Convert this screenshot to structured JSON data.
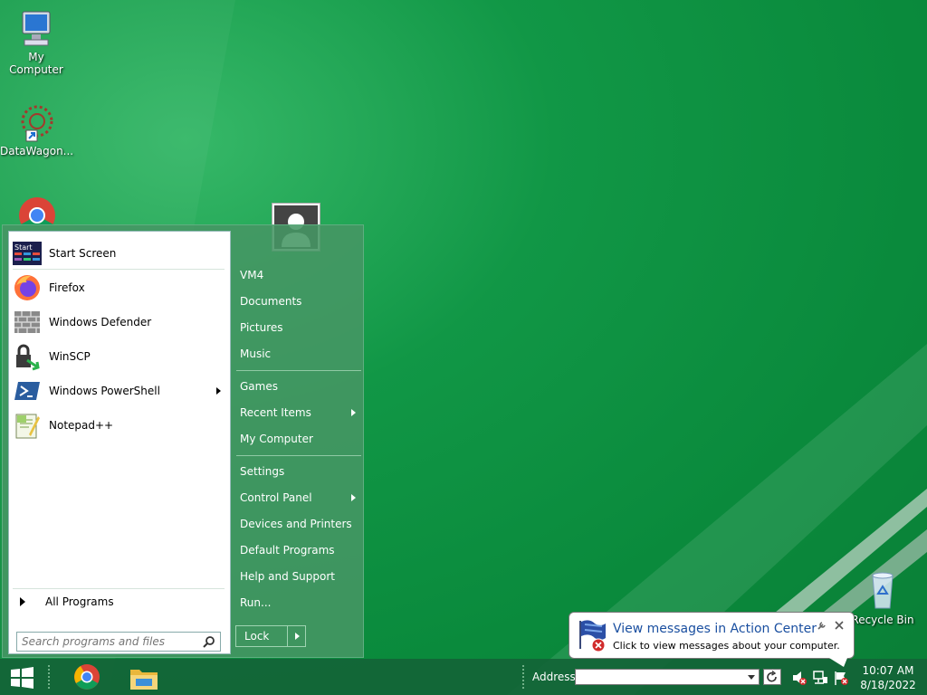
{
  "desktop": {
    "icons": [
      {
        "label": "My Computer"
      },
      {
        "label": "DataWagon..."
      },
      {
        "label": ""
      },
      {
        "label": "Recycle Bin"
      }
    ]
  },
  "start_menu": {
    "programs": [
      {
        "label": "Start Screen",
        "icon": "start-screen-icon"
      },
      {
        "label": "Firefox",
        "icon": "firefox-icon"
      },
      {
        "label": "Windows Defender",
        "icon": "defender-icon"
      },
      {
        "label": "WinSCP",
        "icon": "winscp-icon"
      },
      {
        "label": "Windows PowerShell",
        "icon": "powershell-icon"
      },
      {
        "label": "Notepad++",
        "icon": "notepadpp-icon"
      }
    ],
    "start_screen_icon_text": "Start",
    "all_programs": "All Programs",
    "search_placeholder": "Search programs and files",
    "right_items": [
      {
        "label": "VM4"
      },
      {
        "label": "Documents"
      },
      {
        "label": "Pictures"
      },
      {
        "label": "Music"
      },
      {
        "label": "Games"
      },
      {
        "label": "Recent Items"
      },
      {
        "label": "My Computer"
      },
      {
        "label": "Settings"
      },
      {
        "label": "Control Panel"
      },
      {
        "label": "Devices and Printers"
      },
      {
        "label": "Default Programs"
      },
      {
        "label": "Help and Support"
      },
      {
        "label": "Run..."
      }
    ],
    "lock_label": "Lock"
  },
  "taskbar": {
    "address_label": "Address",
    "address_value": "",
    "clock_time": "10:07 AM",
    "clock_date": "8/18/2022",
    "pinned": [
      "chrome-icon",
      "file-explorer-icon"
    ]
  },
  "notification": {
    "title": "View messages in Action Center",
    "body": "Click to view messages about your computer."
  },
  "colors": {
    "desktop": "#119746",
    "taskbar": "#14643a",
    "link_blue": "#1a4fa0"
  }
}
